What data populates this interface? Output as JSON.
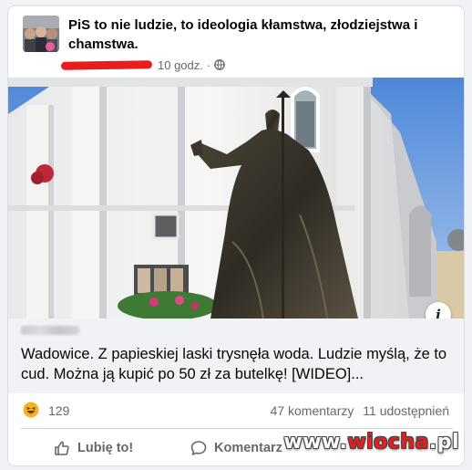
{
  "post": {
    "group_name": "PiS to nie ludzie, to ideologia kłamstwa, złodziejstwa i chamstwa.",
    "time": "10 godz.",
    "separator": "·",
    "audience_icon": "globe-icon"
  },
  "link": {
    "title": "Wadowice. Z papieskiej laski trysnęła woda. Ludzie myślą, że to cud. Można ją kupić po 50 zł za butelkę! [WIDEO]...",
    "info_icon_label": "i"
  },
  "stats": {
    "reaction_icon": "haha-icon",
    "reaction_count": "129",
    "comments": "47 komentarzy",
    "shares": "11 udostępnień"
  },
  "actions": {
    "like_label": "Lubię to!",
    "comment_label": "Komentarz"
  },
  "watermark": {
    "prefix": "www.",
    "name": "wiocha",
    "suffix": ".pl"
  },
  "colors": {
    "redaction": "#e81e1e",
    "secondary_text": "#65676b",
    "haha_yellow": "#f7b125"
  }
}
